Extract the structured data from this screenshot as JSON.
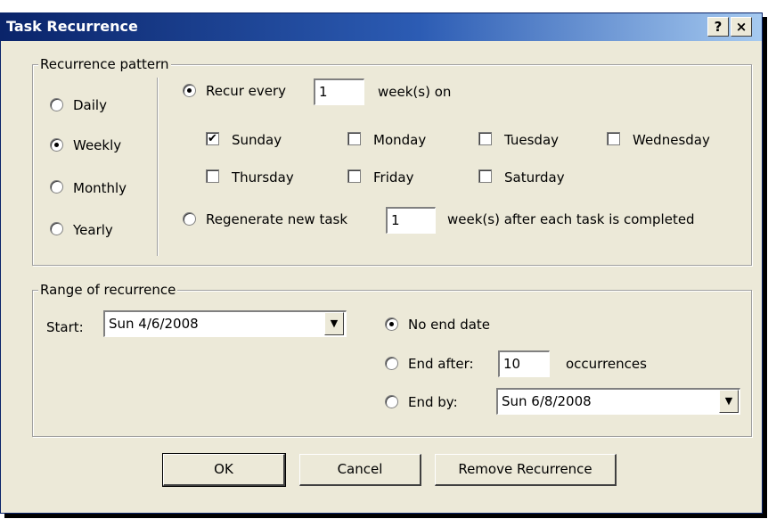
{
  "window": {
    "title": "Task Recurrence",
    "help_label": "?",
    "close_label": "×"
  },
  "pattern": {
    "group_label": "Recurrence pattern",
    "frequencies": [
      {
        "label": "Daily",
        "selected": false
      },
      {
        "label": "Weekly",
        "selected": true
      },
      {
        "label": "Monthly",
        "selected": false
      },
      {
        "label": "Yearly",
        "selected": false
      }
    ],
    "recur_every_label": "Recur every",
    "recur_every_value": "1",
    "recur_every_suffix": "week(s) on",
    "days": [
      {
        "label": "Sunday",
        "checked": true
      },
      {
        "label": "Monday",
        "checked": false
      },
      {
        "label": "Tuesday",
        "checked": false
      },
      {
        "label": "Wednesday",
        "checked": false
      },
      {
        "label": "Thursday",
        "checked": false
      },
      {
        "label": "Friday",
        "checked": false
      },
      {
        "label": "Saturday",
        "checked": false
      }
    ],
    "regenerate_label": "Regenerate new task",
    "regenerate_value": "1",
    "regenerate_suffix": "week(s) after each task is completed"
  },
  "range": {
    "group_label": "Range of recurrence",
    "start_label": "Start:",
    "start_value": "Sun 4/6/2008",
    "no_end_label": "No end date",
    "end_after_label": "End after:",
    "end_after_value": "10",
    "occurrences_label": "occurrences",
    "end_by_label": "End by:",
    "end_by_value": "Sun 6/8/2008"
  },
  "buttons": {
    "ok": "OK",
    "cancel": "Cancel",
    "remove": "Remove Recurrence"
  }
}
